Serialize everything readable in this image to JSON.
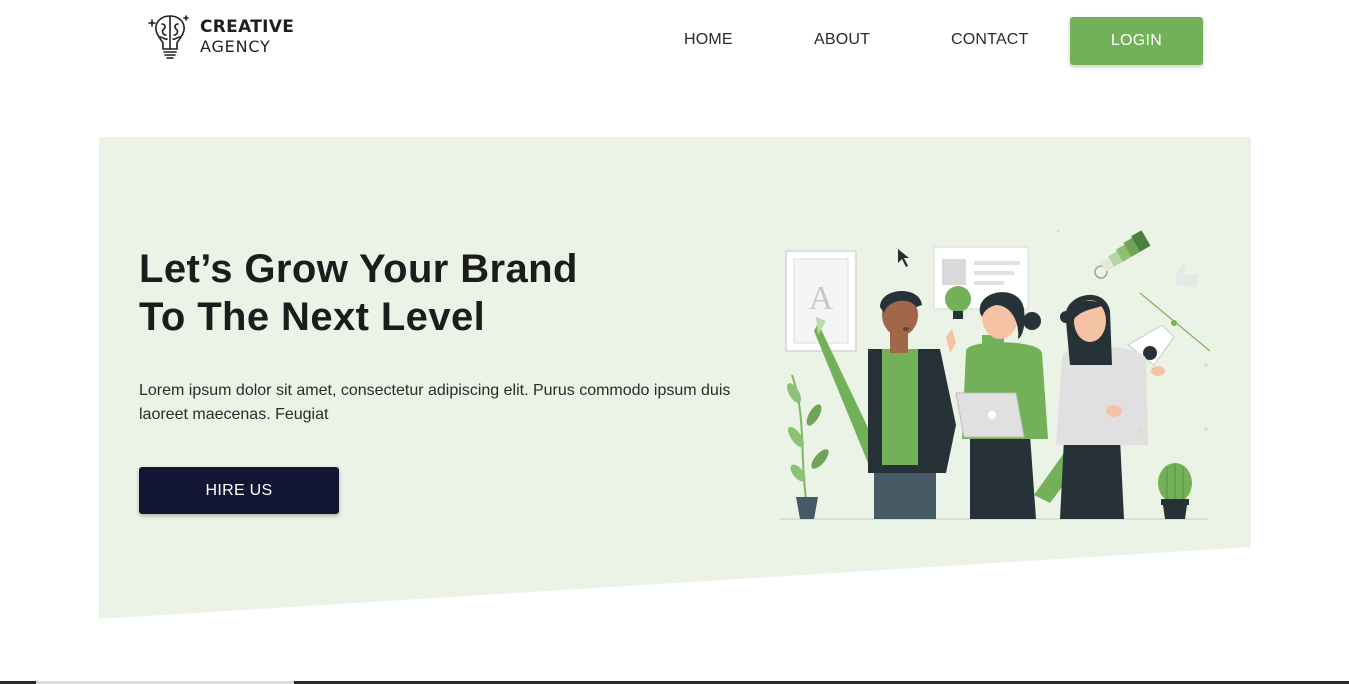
{
  "brand": {
    "line1": "CREATIVE",
    "line2": "AGENCY",
    "icon": "brain-lightbulb-icon"
  },
  "nav": {
    "items": [
      {
        "label": "HOME"
      },
      {
        "label": "ABOUT"
      },
      {
        "label": "CONTACT"
      }
    ],
    "login_label": "LOGIN"
  },
  "hero": {
    "title_line1": "Let’s Grow Your Brand",
    "title_line2": "To The Next Level",
    "description": "Lorem ipsum dolor sit amet, consectetur adipiscing elit. Purus commodo ipsum duis laoreet maecenas. Feugiat",
    "cta_label": "HIRE US",
    "illustration_letter": "A"
  },
  "colors": {
    "accent": "#72b157",
    "hero_background": "#ebf3e6",
    "cta_background": "#121533",
    "text": "#1c1c1c"
  }
}
